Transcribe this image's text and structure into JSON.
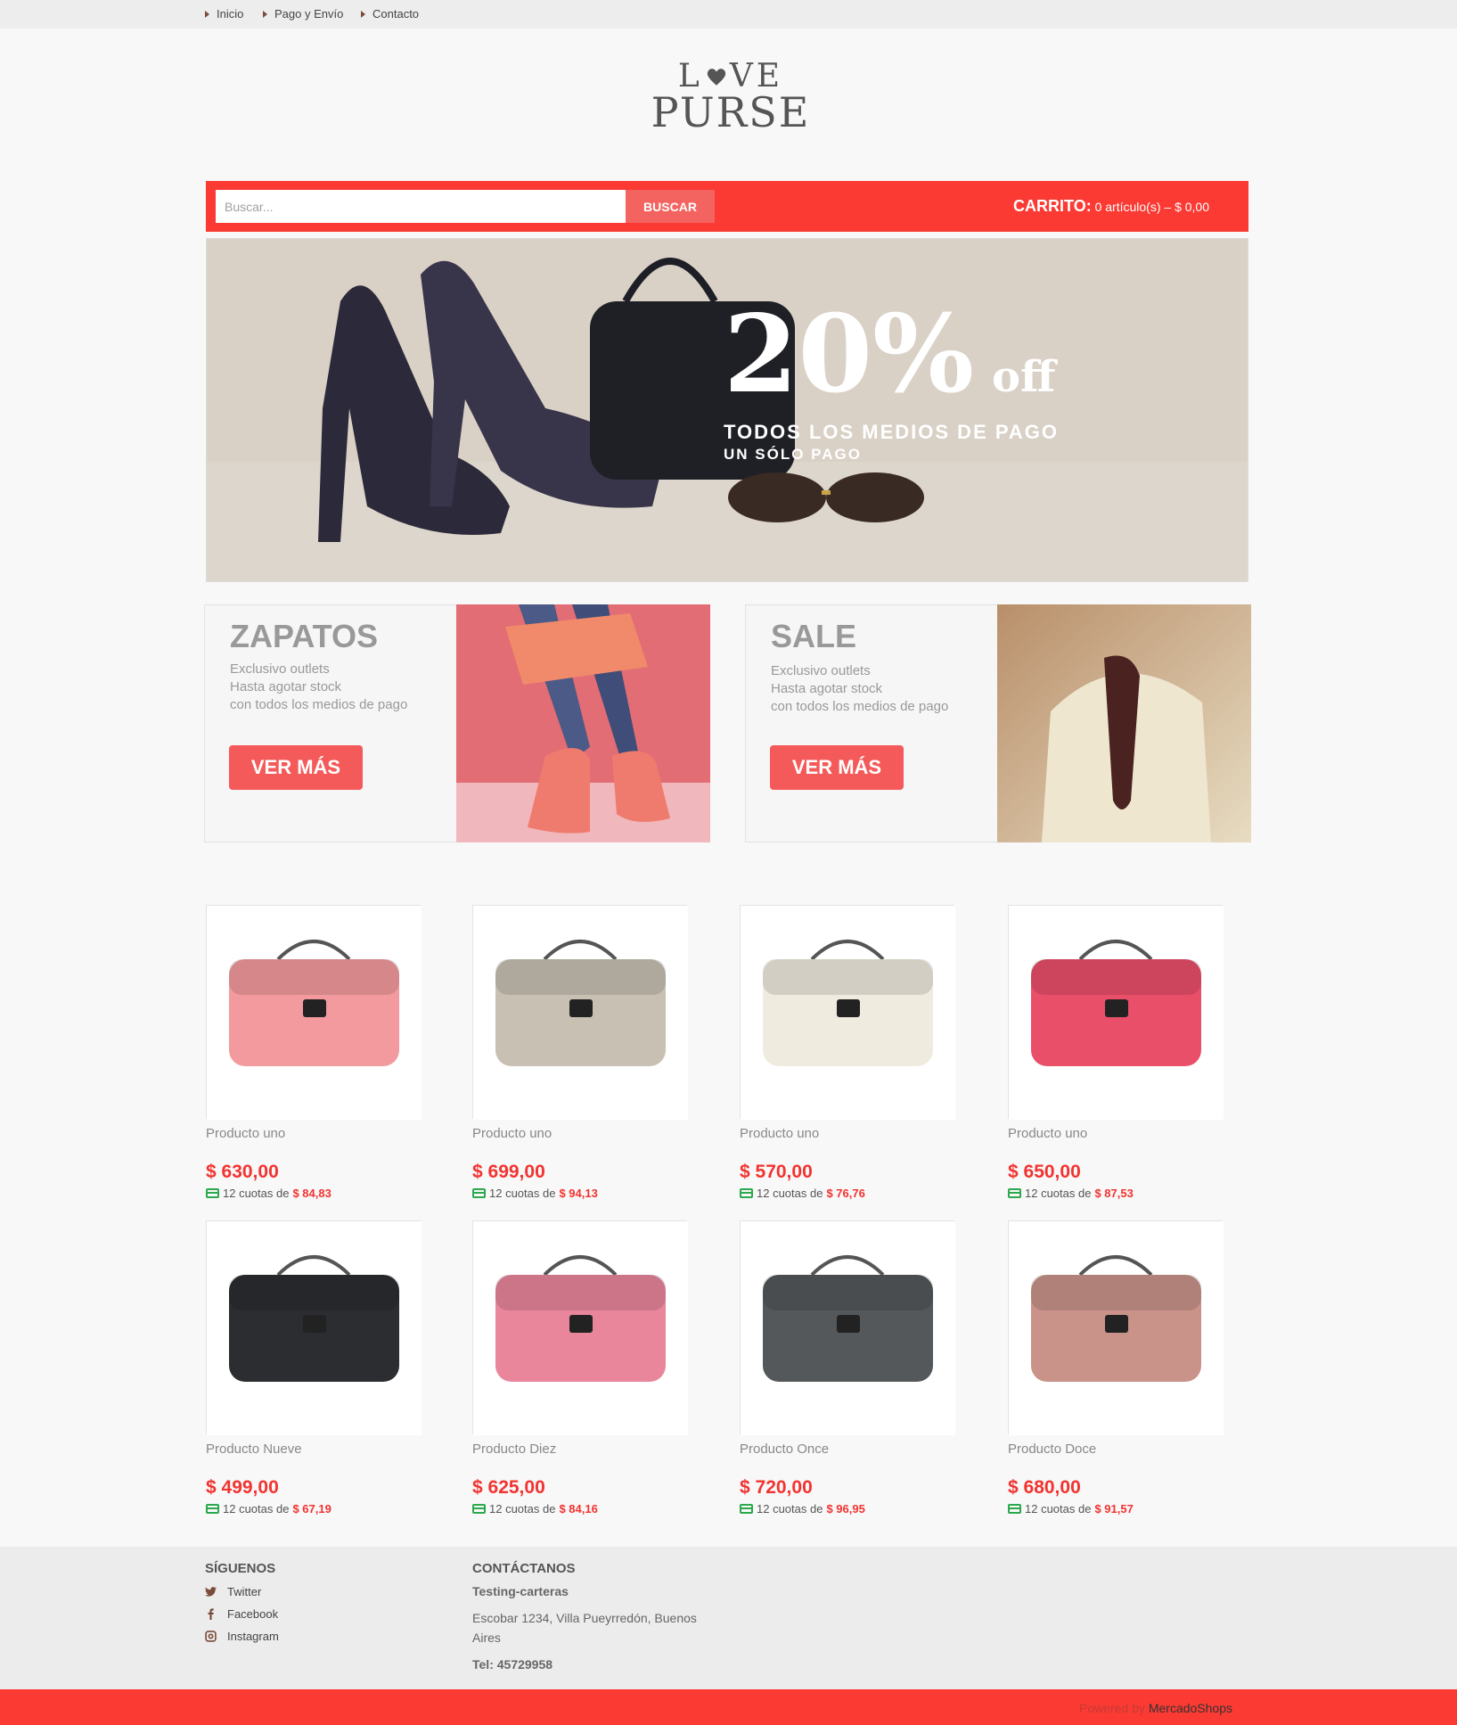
{
  "nav": {
    "items": [
      {
        "label": "Inicio"
      },
      {
        "label": "Pago y Envío"
      },
      {
        "label": "Contacto"
      }
    ]
  },
  "logo": {
    "line1_a": "L",
    "line1_b": "VE",
    "line2": "PURSE"
  },
  "search": {
    "placeholder": "Buscar...",
    "button_label": "BUSCAR"
  },
  "cart": {
    "label": "CARRITO:",
    "summary": "0 artículo(s) – $ 0,00"
  },
  "hero": {
    "percent": "20%",
    "off": "off",
    "line1": "TODOS LOS MEDIOS DE PAGO",
    "line2": "UN SÓLO PAGO"
  },
  "promos": [
    {
      "title": "ZAPATOS",
      "lines": [
        "Exclusivo outlets",
        "Hasta agotar stock",
        "con todos los medios de pago"
      ],
      "button": "VER MÁS"
    },
    {
      "title": "SALE",
      "lines": [
        "Exclusivo outlets",
        "Hasta agotar stock",
        "con todos los medios de pago"
      ],
      "button": "VER MÁS"
    }
  ],
  "products": [
    {
      "name": "Producto uno",
      "price": "$ 630,00",
      "cuotas_label": "12 cuotas de",
      "cuota": "$ 84,83",
      "color": "#f39a9e"
    },
    {
      "name": "Producto uno",
      "price": "$ 699,00",
      "cuotas_label": "12 cuotas de",
      "cuota": "$ 94,13",
      "color": "#c8c0b3"
    },
    {
      "name": "Producto uno",
      "price": "$ 570,00",
      "cuotas_label": "12 cuotas de",
      "cuota": "$ 76,76",
      "color": "#f0ebdf"
    },
    {
      "name": "Producto uno",
      "price": "$ 650,00",
      "cuotas_label": "12 cuotas de",
      "cuota": "$ 87,53",
      "color": "#ea4f6a"
    },
    {
      "name": "Producto Nueve",
      "price": "$ 499,00",
      "cuotas_label": "12 cuotas de",
      "cuota": "$ 67,19",
      "color": "#2b2d30"
    },
    {
      "name": "Producto Diez",
      "price": "$ 625,00",
      "cuotas_label": "12 cuotas de",
      "cuota": "$ 84,16",
      "color": "#e9869c"
    },
    {
      "name": "Producto Once",
      "price": "$ 720,00",
      "cuotas_label": "12 cuotas de",
      "cuota": "$ 96,95",
      "color": "#54585a"
    },
    {
      "name": "Producto Doce",
      "price": "$ 680,00",
      "cuotas_label": "12 cuotas de",
      "cuota": "$ 91,57",
      "color": "#c99389"
    }
  ],
  "footer": {
    "follow_title": "SÍGUENOS",
    "social": [
      {
        "label": "Twitter",
        "icon": "twitter-icon"
      },
      {
        "label": "Facebook",
        "icon": "facebook-icon"
      },
      {
        "label": "Instagram",
        "icon": "instagram-icon"
      }
    ],
    "contact_title": "CONTÁCTANOS",
    "company": "Testing-carteras",
    "address": "Escobar 1234, Villa Pueyrredón, Buenos Aires",
    "phone": "Tel: 45729958"
  },
  "powered": {
    "prefix": "Powered by",
    "brand": "MercadoShops"
  },
  "colors": {
    "accent": "#fb3a33",
    "button": "#f45a59",
    "price": "#f23330",
    "card": "#2ca84d"
  }
}
